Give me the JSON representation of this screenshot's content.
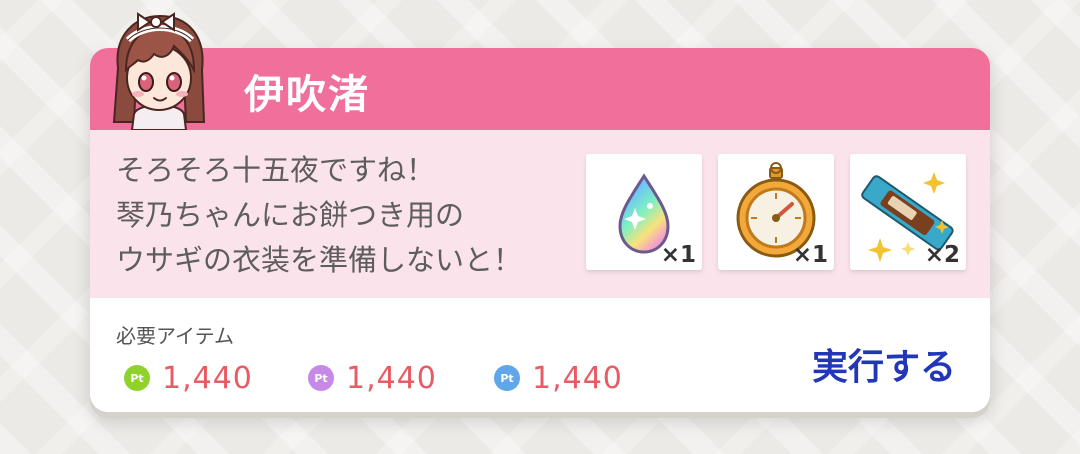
{
  "character": {
    "name": "伊吹渚"
  },
  "message": {
    "lines": [
      "そろそろ十五夜ですね！",
      "琴乃ちゃんにお餅つき用の",
      "ウサギの衣装を準備しないと！"
    ]
  },
  "rewards": [
    {
      "icon": "rainbow-drop-icon",
      "quantity": "×1"
    },
    {
      "icon": "stopwatch-icon",
      "quantity": "×1"
    },
    {
      "icon": "snack-bar-icon",
      "quantity": "×2"
    }
  ],
  "requirements": {
    "label": "必要アイテム",
    "costs": [
      {
        "icon": "pt-green-icon",
        "badge": "Pt",
        "color": "#8fd22c",
        "value": "1,440"
      },
      {
        "icon": "pt-purple-icon",
        "badge": "Pt",
        "color": "#c68ae6",
        "value": "1,440"
      },
      {
        "icon": "pt-blue-icon",
        "badge": "Pt",
        "color": "#5fa6ea",
        "value": "1,440"
      }
    ]
  },
  "action": {
    "label": "実行する"
  },
  "colors": {
    "header": "#f0709b",
    "body": "#fbe3ec",
    "cost_text": "#e85b64",
    "action": "#2236b8"
  }
}
